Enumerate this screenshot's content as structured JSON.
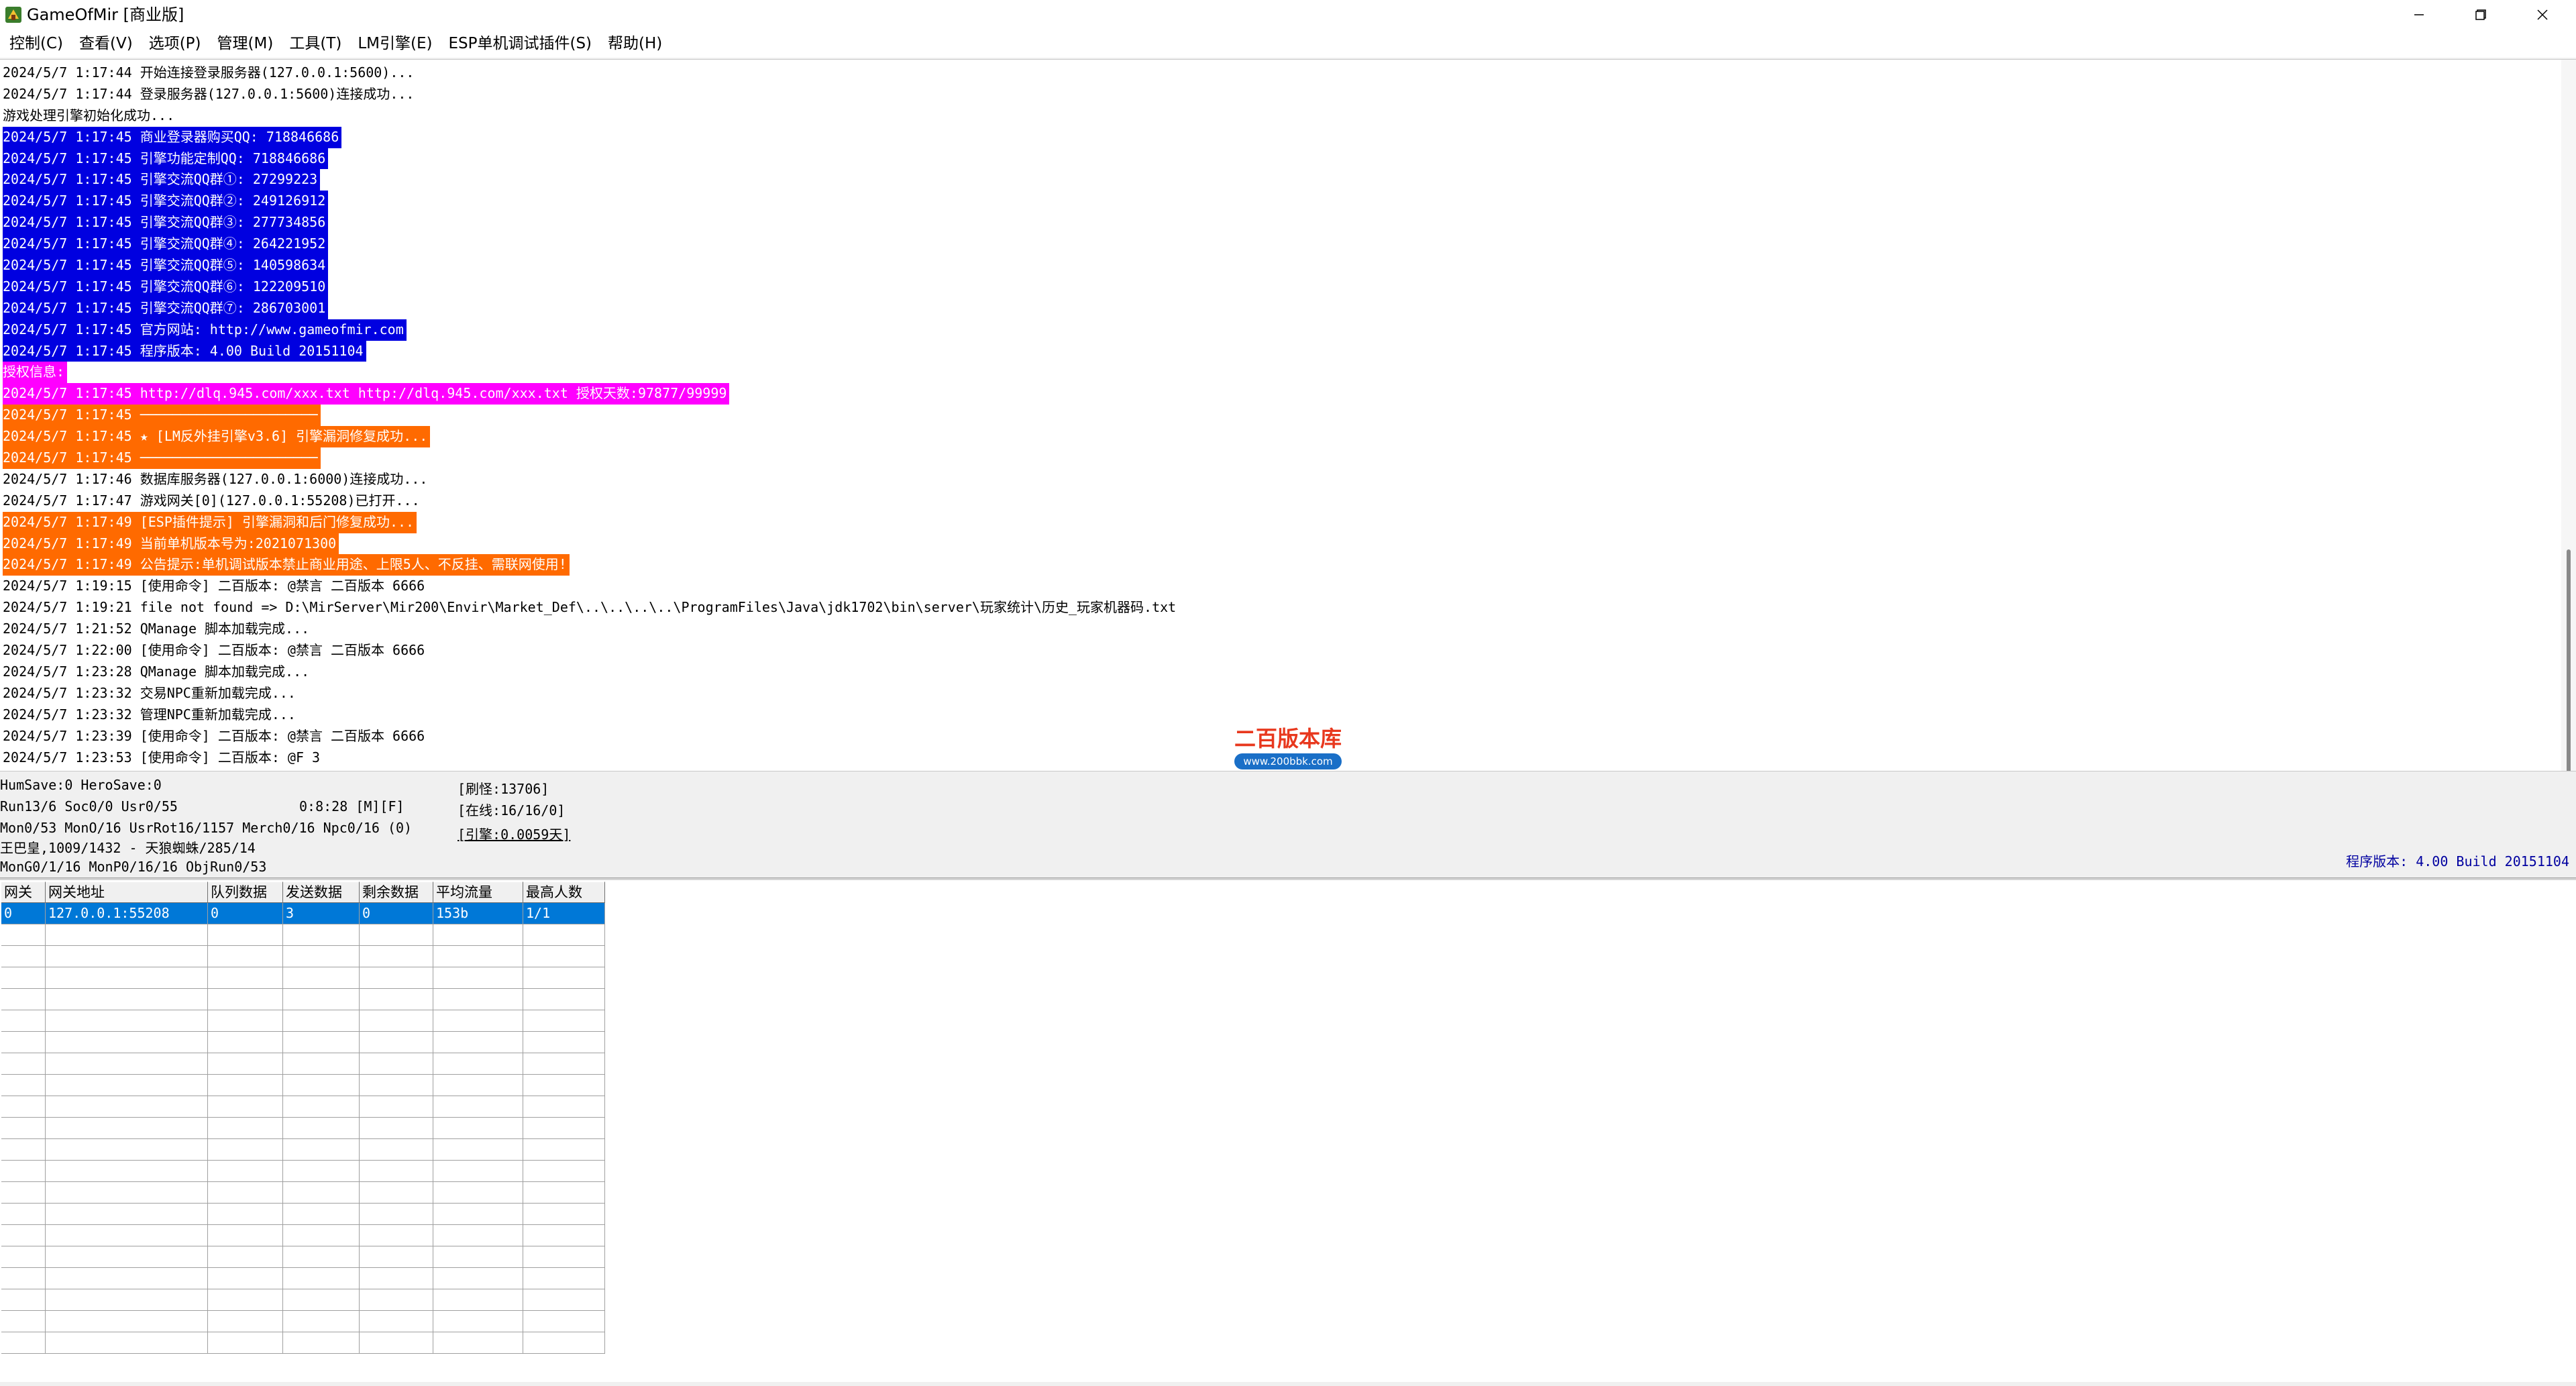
{
  "window": {
    "title": "GameOfMir [商业版]",
    "app_icon": "gameofmir-app-icon",
    "controls": [
      "minimize-icon",
      "maximize-icon",
      "close-icon"
    ]
  },
  "menu": {
    "items": [
      {
        "label": "控制(C)"
      },
      {
        "label": "查看(V)"
      },
      {
        "label": "选项(P)"
      },
      {
        "label": "管理(M)"
      },
      {
        "label": "工具(T)"
      },
      {
        "label": "LM引擎(E)"
      },
      {
        "label": "ESP单机调试插件(S)"
      },
      {
        "label": "帮助(H)"
      }
    ]
  },
  "colors": {
    "blue_highlight": "#0000e0",
    "magenta_highlight": "#ff00ff",
    "orange_highlight": "#ff6a00",
    "selection": "#0078d7",
    "version_text": "#0000a0"
  },
  "log": {
    "lines": [
      {
        "text": "2024/5/7 1:17:44 开始连接登录服务器(127.0.0.1:5600)...",
        "style": "plain"
      },
      {
        "text": "2024/5/7 1:17:44 登录服务器(127.0.0.1:5600)连接成功...",
        "style": "plain"
      },
      {
        "text": "游戏处理引擎初始化成功...",
        "style": "plain"
      },
      {
        "text": "2024/5/7 1:17:45 商业登录器购买QQ: 718846686",
        "style": "blue"
      },
      {
        "text": "2024/5/7 1:17:45 引擎功能定制QQ: 718846686",
        "style": "blue"
      },
      {
        "text": "2024/5/7 1:17:45 引擎交流QQ群①: 27299223",
        "style": "blue"
      },
      {
        "text": "2024/5/7 1:17:45 引擎交流QQ群②: 249126912",
        "style": "blue"
      },
      {
        "text": "2024/5/7 1:17:45 引擎交流QQ群③: 277734856",
        "style": "blue"
      },
      {
        "text": "2024/5/7 1:17:45 引擎交流QQ群④: 264221952",
        "style": "blue"
      },
      {
        "text": "2024/5/7 1:17:45 引擎交流QQ群⑤: 140598634",
        "style": "blue"
      },
      {
        "text": "2024/5/7 1:17:45 引擎交流QQ群⑥: 122209510",
        "style": "blue"
      },
      {
        "text": "2024/5/7 1:17:45 引擎交流QQ群⑦: 286703001",
        "style": "blue"
      },
      {
        "text": "2024/5/7 1:17:45 官方网站: http://www.gameofmir.com",
        "style": "blue"
      },
      {
        "text": "2024/5/7 1:17:45 程序版本: 4.00 Build 20151104",
        "style": "blue"
      },
      {
        "text": "授权信息:",
        "style": "magenta"
      },
      {
        "text": "2024/5/7 1:17:45 http://dlq.945.com/xxx.txt http://dlq.945.com/xxx.txt 授权天数:97877/99999",
        "style": "magenta"
      },
      {
        "text": "2024/5/7 1:17:45 ──────────────────────",
        "style": "orange"
      },
      {
        "text": "2024/5/7 1:17:45 ★ [LM反外挂引擎v3.6] 引擎漏洞修复成功...",
        "style": "orange"
      },
      {
        "text": "2024/5/7 1:17:45 ──────────────────────",
        "style": "orange"
      },
      {
        "text": "2024/5/7 1:17:46 数据库服务器(127.0.0.1:6000)连接成功...",
        "style": "plain"
      },
      {
        "text": "2024/5/7 1:17:47 游戏网关[0](127.0.0.1:55208)已打开...",
        "style": "plain"
      },
      {
        "text": "2024/5/7 1:17:49 [ESP插件提示] 引擎漏洞和后门修复成功...",
        "style": "orange"
      },
      {
        "text": "2024/5/7 1:17:49 当前单机版本号为:2021071300",
        "style": "orange"
      },
      {
        "text": "2024/5/7 1:17:49 公告提示:单机调试版本禁止商业用途、上限5人、不反挂、需联网使用!",
        "style": "orange"
      },
      {
        "text": "2024/5/7 1:19:15 [使用命令] 二百版本: @禁言 二百版本 6666",
        "style": "plain"
      },
      {
        "text": "2024/5/7 1:19:21 file not found => D:\\MirServer\\Mir200\\Envir\\Market_Def\\..\\..\\..\\..\\ProgramFiles\\Java\\jdk1702\\bin\\server\\玩家统计\\历史_玩家机器码.txt",
        "style": "plain"
      },
      {
        "text": "2024/5/7 1:21:52 QManage 脚本加载完成...",
        "style": "plain"
      },
      {
        "text": "2024/5/7 1:22:00 [使用命令] 二百版本: @禁言 二百版本 6666",
        "style": "plain"
      },
      {
        "text": "2024/5/7 1:23:28 QManage 脚本加载完成...",
        "style": "plain"
      },
      {
        "text": "2024/5/7 1:23:32 交易NPC重新加载完成...",
        "style": "plain"
      },
      {
        "text": "2024/5/7 1:23:32 管理NPC重新加载完成...",
        "style": "plain"
      },
      {
        "text": "2024/5/7 1:23:39 [使用命令] 二百版本: @禁言 二百版本 6666",
        "style": "plain"
      },
      {
        "text": "2024/5/7 1:23:53 [使用命令] 二百版本: @F 3",
        "style": "plain"
      }
    ]
  },
  "watermark": {
    "title": "二百版本库",
    "url": "www.200bbk.com"
  },
  "status": {
    "hum_save": "HumSave:0 HeroSave:0",
    "run_info": "Run13/6 Soc0/0 Usr0/55",
    "timer": "0:8:28 [M][F]",
    "mon_info": "Mon0/53 MonO/16 UsrRot16/1157 Merch0/16 Npc0/16 (0)",
    "map_info": "王巴皇,1009/1432 - 天狼蜘蛛/285/14",
    "mon_gen": "MonG0/1/16 MonP0/16/16 ObjRun0/53",
    "refresh": "[刷怪:13706]",
    "online": "[在线:16/16/0]",
    "engine": "[引擎:0.0059天]",
    "version": "程序版本: 4.00 Build 20151104"
  },
  "grid": {
    "headers": [
      "网关",
      "网关地址",
      "队列数据",
      "发送数据",
      "剩余数据",
      "平均流量",
      "最高人数"
    ],
    "rows": [
      [
        "0",
        "127.0.0.1:55208",
        "0",
        "3",
        "0",
        "153b",
        "1/1"
      ]
    ],
    "empty_rows": 20
  }
}
